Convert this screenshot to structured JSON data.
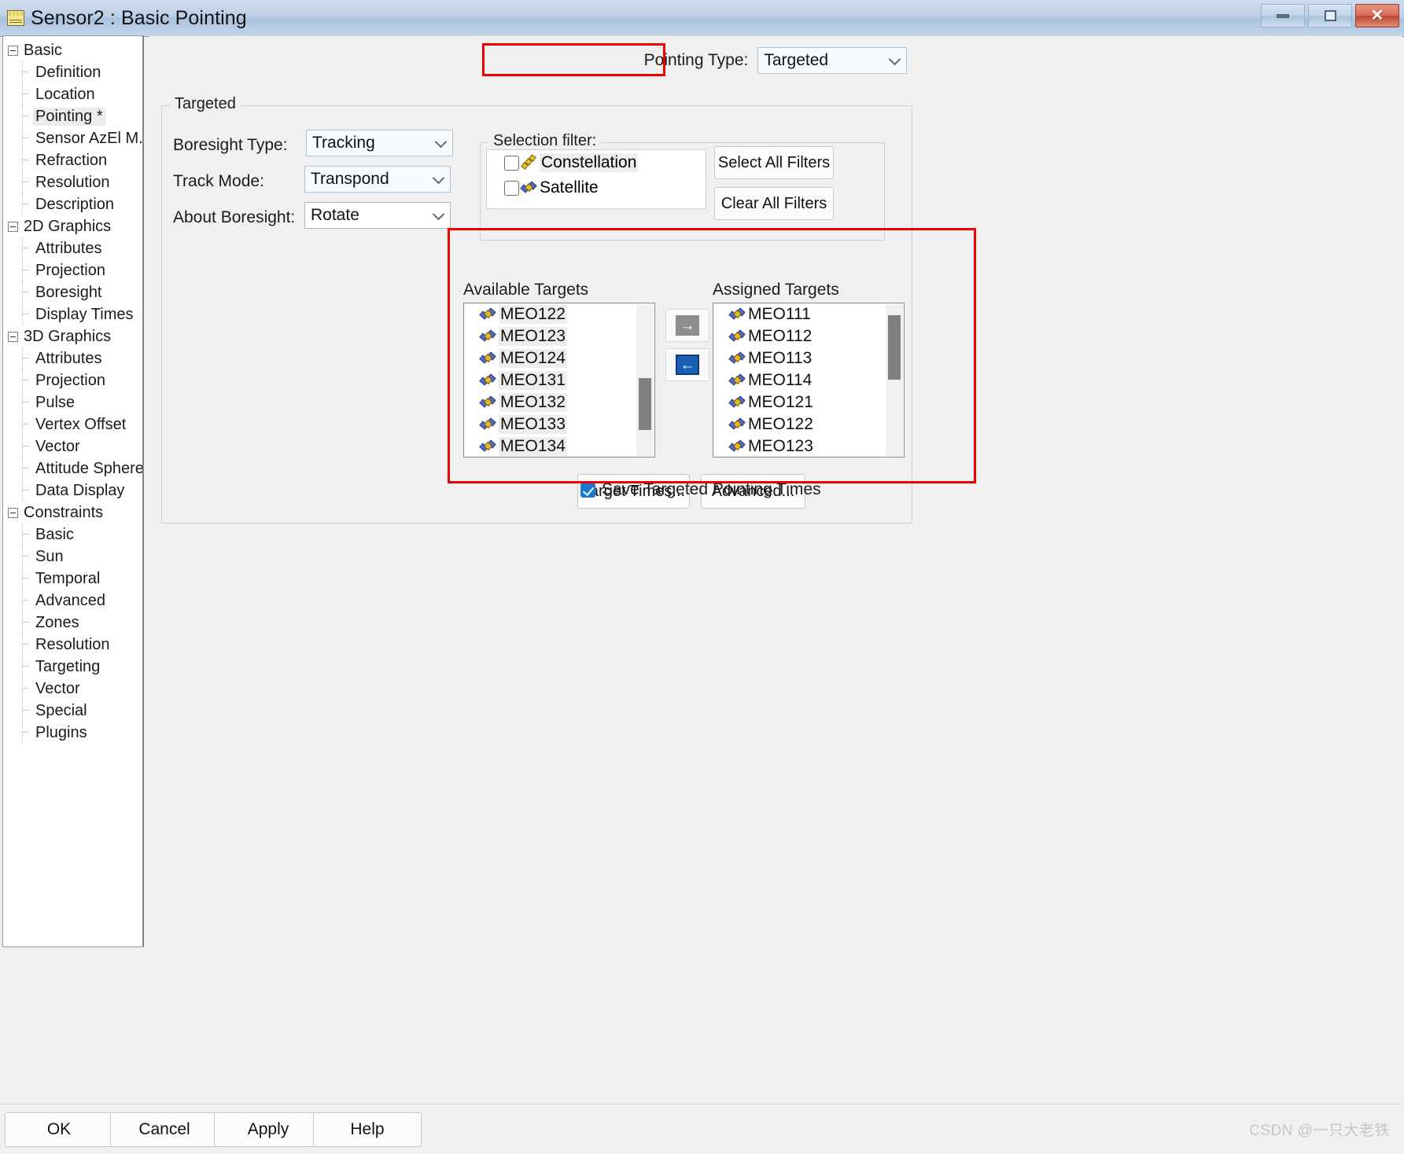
{
  "window": {
    "title": "Sensor2 : Basic Pointing",
    "icon": "window-document-icon",
    "minimize_label": "–",
    "maximize_label": "□",
    "close_label": "✕"
  },
  "sidebar": {
    "items": [
      {
        "label": "Basic",
        "level": "root",
        "expander": true,
        "selected": false
      },
      {
        "label": "Definition",
        "level": "child",
        "expander": false,
        "selected": false
      },
      {
        "label": "Location",
        "level": "child",
        "expander": false,
        "selected": false
      },
      {
        "label": "Pointing *",
        "level": "child",
        "expander": false,
        "selected": true
      },
      {
        "label": "Sensor AzEl M...",
        "level": "child",
        "expander": false,
        "selected": false
      },
      {
        "label": "Refraction",
        "level": "child",
        "expander": false,
        "selected": false
      },
      {
        "label": "Resolution",
        "level": "child",
        "expander": false,
        "selected": false
      },
      {
        "label": "Description",
        "level": "child",
        "expander": false,
        "selected": false
      },
      {
        "label": "2D Graphics",
        "level": "root",
        "expander": true,
        "selected": false
      },
      {
        "label": "Attributes",
        "level": "child",
        "expander": false,
        "selected": false
      },
      {
        "label": "Projection",
        "level": "child",
        "expander": false,
        "selected": false
      },
      {
        "label": "Boresight",
        "level": "child",
        "expander": false,
        "selected": false
      },
      {
        "label": "Display Times",
        "level": "child",
        "expander": false,
        "selected": false
      },
      {
        "label": "3D Graphics",
        "level": "root",
        "expander": true,
        "selected": false
      },
      {
        "label": "Attributes",
        "level": "child",
        "expander": false,
        "selected": false
      },
      {
        "label": "Projection",
        "level": "child",
        "expander": false,
        "selected": false
      },
      {
        "label": "Pulse",
        "level": "child",
        "expander": false,
        "selected": false
      },
      {
        "label": "Vertex Offset",
        "level": "child",
        "expander": false,
        "selected": false
      },
      {
        "label": "Vector",
        "level": "child",
        "expander": false,
        "selected": false
      },
      {
        "label": "Attitude Sphere",
        "level": "child",
        "expander": false,
        "selected": false
      },
      {
        "label": "Data Display",
        "level": "child",
        "expander": false,
        "selected": false
      },
      {
        "label": "Constraints",
        "level": "root",
        "expander": true,
        "selected": false
      },
      {
        "label": "Basic",
        "level": "child",
        "expander": false,
        "selected": false
      },
      {
        "label": "Sun",
        "level": "child",
        "expander": false,
        "selected": false
      },
      {
        "label": "Temporal",
        "level": "child",
        "expander": false,
        "selected": false
      },
      {
        "label": "Advanced",
        "level": "child",
        "expander": false,
        "selected": false
      },
      {
        "label": "Zones",
        "level": "child",
        "expander": false,
        "selected": false
      },
      {
        "label": "Resolution",
        "level": "child",
        "expander": false,
        "selected": false
      },
      {
        "label": "Targeting",
        "level": "child",
        "expander": false,
        "selected": false
      },
      {
        "label": "Vector",
        "level": "child",
        "expander": false,
        "selected": false
      },
      {
        "label": "Special",
        "level": "child",
        "expander": false,
        "selected": false
      },
      {
        "label": "Plugins",
        "level": "child",
        "expander": false,
        "selected": false
      }
    ]
  },
  "main": {
    "pointing_type": {
      "label": "Pointing Type:",
      "value": "Targeted"
    },
    "targeted_group_title": "Targeted",
    "boresight_type": {
      "label": "Boresight Type:",
      "value": "Tracking"
    },
    "track_mode": {
      "label": "Track Mode:",
      "value": "Transpond"
    },
    "about_boresight": {
      "label": "About Boresight:",
      "value": "Rotate"
    },
    "selection_filter": {
      "title": "Selection filter:",
      "items": [
        {
          "label": "Constellation",
          "checked": false,
          "icon": "constellation-icon",
          "highlighted": true
        },
        {
          "label": "Satellite",
          "checked": false,
          "icon": "satellite-icon",
          "highlighted": false
        }
      ],
      "select_all_label": "Select All Filters",
      "clear_all_label": "Clear All Filters"
    },
    "available_targets": {
      "title": "Available Targets",
      "items": [
        "MEO122",
        "MEO123",
        "MEO124",
        "MEO131",
        "MEO132",
        "MEO133",
        "MEO134"
      ]
    },
    "assigned_targets": {
      "title": "Assigned Targets",
      "items": [
        "MEO111",
        "MEO112",
        "MEO113",
        "MEO114",
        "MEO121",
        "MEO122",
        "MEO123"
      ]
    },
    "assign_button_label": "→",
    "unassign_button_label": "←",
    "target_times_label": "Target Times...",
    "advanced_label": "Advanced...",
    "save_times": {
      "label": "Save Targeted Pointing Times",
      "checked": true
    }
  },
  "footer": {
    "ok": "OK",
    "cancel": "Cancel",
    "apply": "Apply",
    "help": "Help"
  },
  "watermark": "CSDN @一只大老铁",
  "colors": {
    "accent_blue": "#1878d4",
    "annotation_red": "#ee0000",
    "title_gradient_start": "#cfdced",
    "close_red": "#c2442f"
  }
}
